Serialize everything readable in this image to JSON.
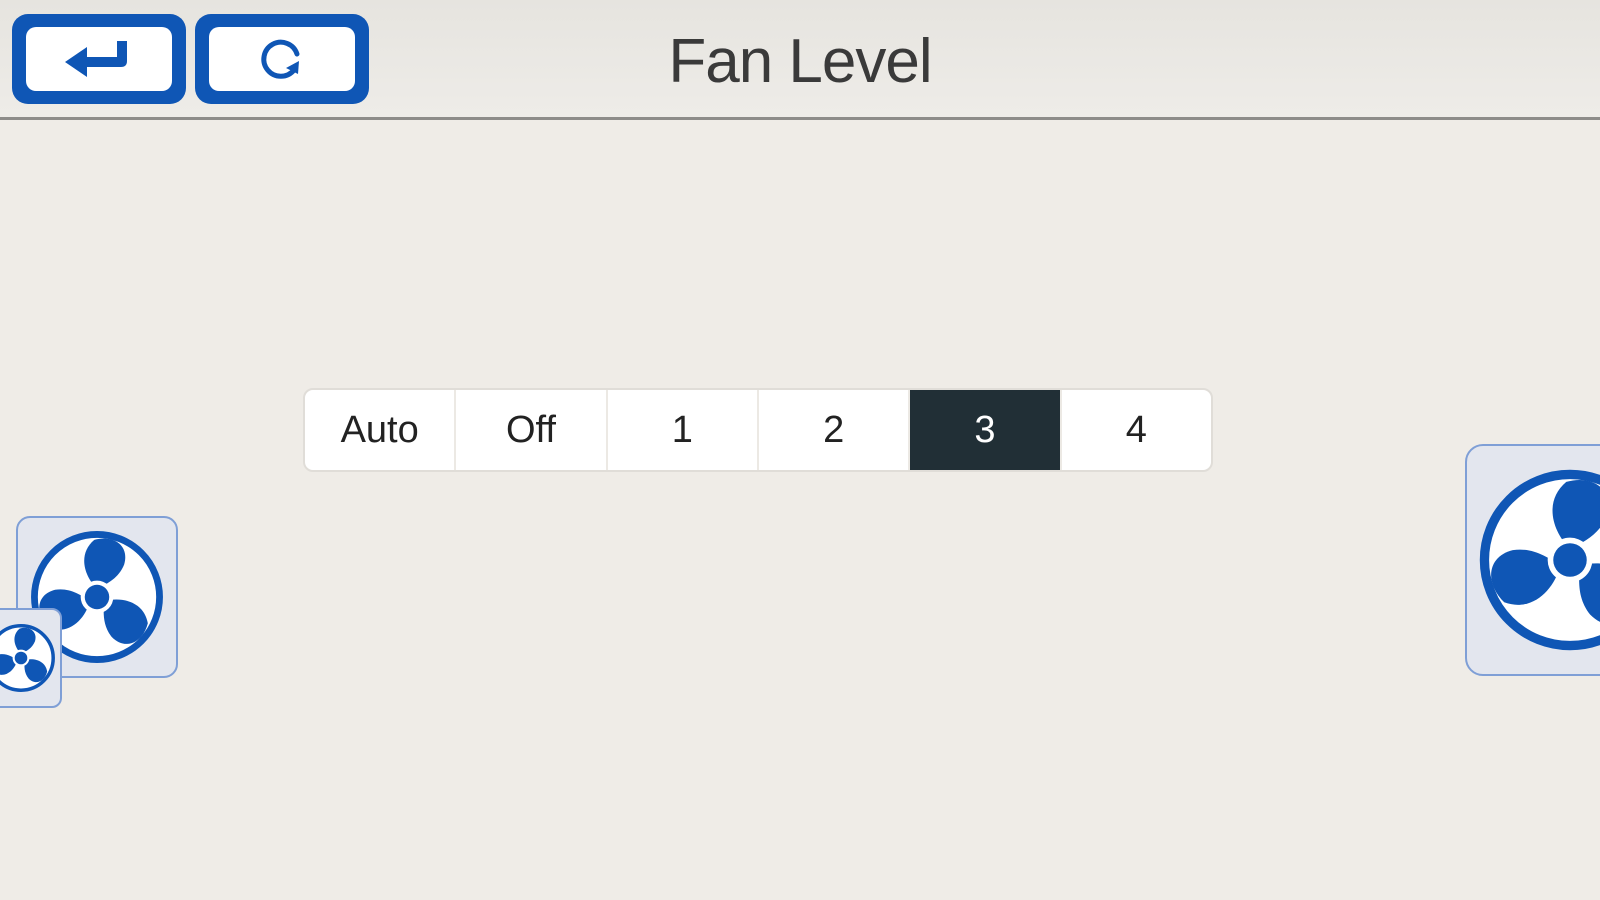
{
  "header": {
    "title": "Fan Level",
    "back_button_icon": "back-arrow-icon",
    "refresh_button_icon": "refresh-icon"
  },
  "fan_level": {
    "options": [
      "Auto",
      "Off",
      "1",
      "2",
      "3",
      "4"
    ],
    "selected": "3"
  },
  "colors": {
    "accent": "#0f56b5",
    "selected_segment": "#212f36",
    "background": "#efece7"
  },
  "icons": {
    "fan": "fan-icon"
  }
}
